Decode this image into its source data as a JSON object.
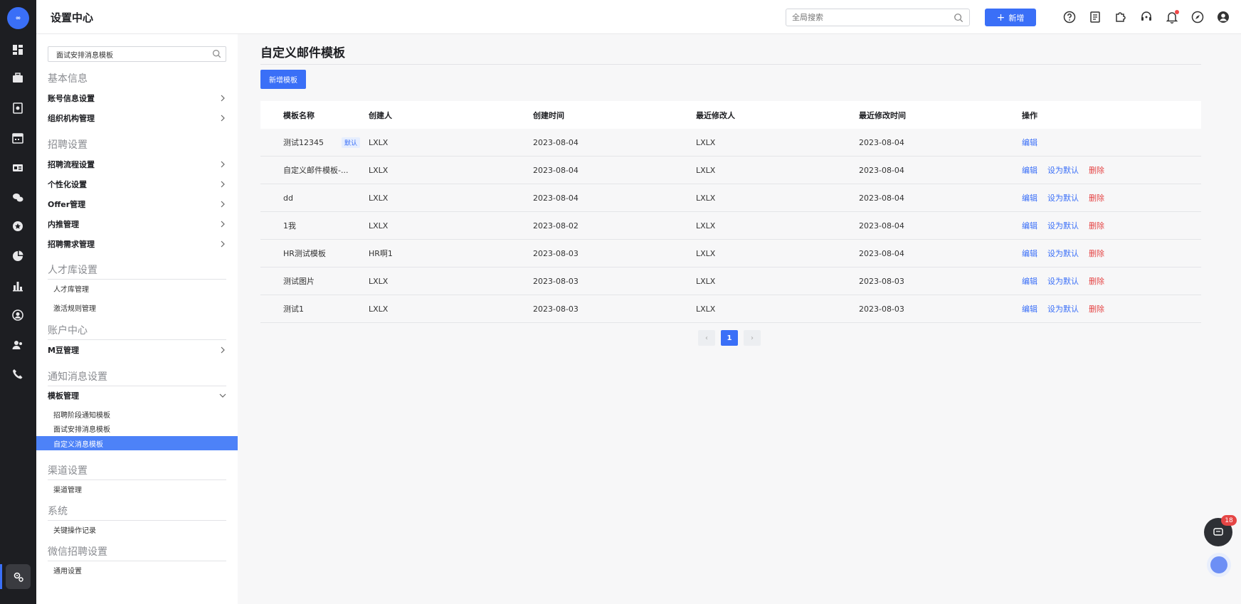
{
  "app": {
    "title": "设置中心",
    "logo_text": "∞"
  },
  "topbar": {
    "search_placeholder": "全局搜索",
    "add_label": "新增"
  },
  "sidebar": {
    "search_value": "面试安排消息模板",
    "sections": {
      "basic": {
        "title": "基本信息",
        "items": [
          "账号信息设置",
          "组织机构管理"
        ]
      },
      "recruit": {
        "title": "招聘设置",
        "items": [
          "招聘流程设置",
          "个性化设置",
          "Offer管理",
          "内推管理",
          "招聘需求管理"
        ]
      },
      "talent": {
        "title": "人才库设置",
        "subs": [
          "人才库管理",
          "激活规则管理"
        ]
      },
      "account": {
        "title": "账户中心",
        "items": [
          "M豆管理"
        ]
      },
      "notify": {
        "title": "通知消息设置",
        "group": "模板管理",
        "subs": [
          "招聘阶段通知模板",
          "面试安排消息模板",
          "自定义消息模板"
        ]
      },
      "channel": {
        "title": "渠道设置",
        "subs": [
          "渠道管理"
        ]
      },
      "system": {
        "title": "系统",
        "subs": [
          "关键操作记录"
        ]
      },
      "wechat": {
        "title": "微信招聘设置",
        "subs": [
          "通用设置"
        ]
      }
    }
  },
  "main": {
    "title": "自定义邮件模板",
    "new_button": "新增模板",
    "columns": [
      "模板名称",
      "创建人",
      "创建时间",
      "最近修改人",
      "最近修改时间",
      "操作"
    ],
    "default_badge": "默认",
    "actions": {
      "edit": "编辑",
      "set_default": "设为默认",
      "delete": "删除"
    },
    "rows": [
      {
        "name": "测试12345",
        "creator": "LXLX",
        "created": "2023-08-04",
        "modifier": "LXLX",
        "modified": "2023-08-04",
        "is_default": true
      },
      {
        "name": "自定义邮件模板-...",
        "creator": "LXLX",
        "created": "2023-08-04",
        "modifier": "LXLX",
        "modified": "2023-08-04",
        "is_default": false
      },
      {
        "name": "dd",
        "creator": "LXLX",
        "created": "2023-08-04",
        "modifier": "LXLX",
        "modified": "2023-08-04",
        "is_default": false
      },
      {
        "name": "1我",
        "creator": "LXLX",
        "created": "2023-08-02",
        "modifier": "LXLX",
        "modified": "2023-08-04",
        "is_default": false
      },
      {
        "name": "HR测试模板",
        "creator": "HR啊1",
        "created": "2023-08-03",
        "modifier": "LXLX",
        "modified": "2023-08-04",
        "is_default": false
      },
      {
        "name": "测试图片",
        "creator": "LXLX",
        "created": "2023-08-03",
        "modifier": "LXLX",
        "modified": "2023-08-03",
        "is_default": false
      },
      {
        "name": "测试1",
        "creator": "LXLX",
        "created": "2023-08-03",
        "modifier": "LXLX",
        "modified": "2023-08-03",
        "is_default": false
      }
    ],
    "pager": {
      "current": "1",
      "prev": "‹",
      "next": "›"
    }
  },
  "chat": {
    "unread": "18"
  },
  "colors": {
    "accent": "#3a6ff7",
    "danger": "#e54545",
    "rail": "#1d1e22"
  }
}
